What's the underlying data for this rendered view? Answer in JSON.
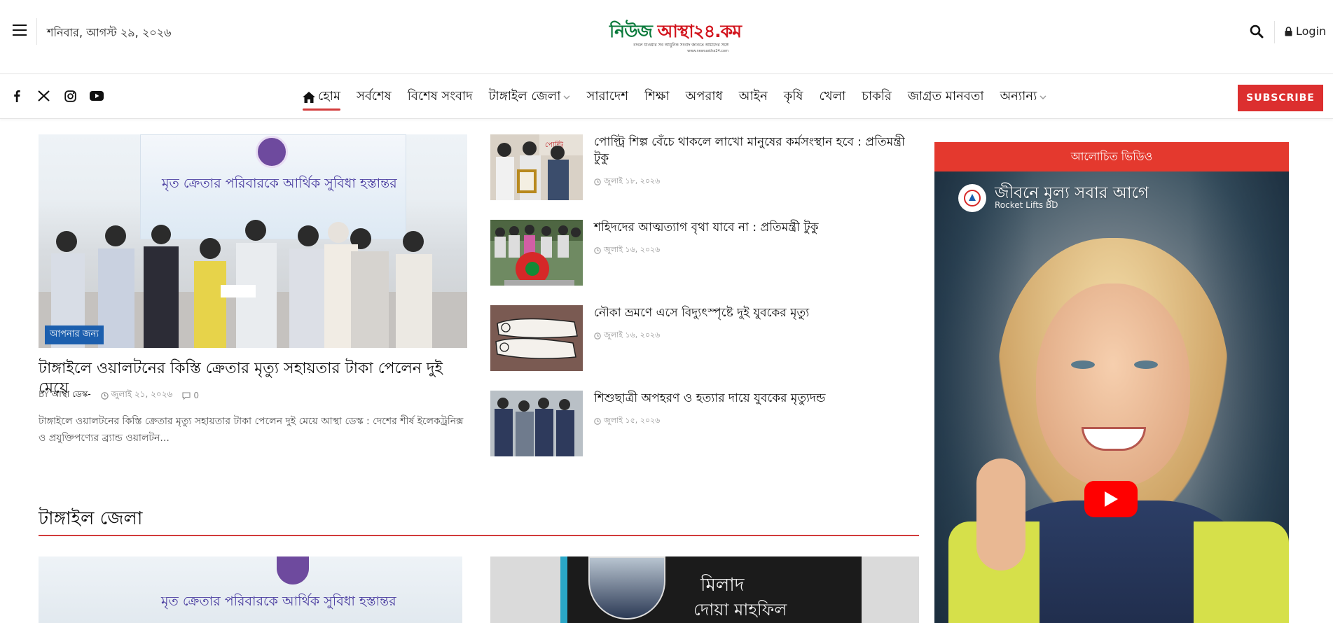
{
  "header": {
    "date": "শনিবার, আগস্ট ২৯, ২০২৬",
    "logo_part1": "নিউজ",
    "logo_part2": "আস্থা",
    "logo_part3": "২৪.কম",
    "logo_tagline": "বদলে যাওয়ার সব আধুনিক সংবাদ জানতে আমাদের সঙ্গে",
    "logo_url": "www.newsastha24.com",
    "login_label": "Login"
  },
  "social": [
    "facebook-icon",
    "x-icon",
    "instagram-icon",
    "youtube-icon"
  ],
  "nav": {
    "items": [
      {
        "label": "হোম",
        "active": true,
        "icon": "home-icon"
      },
      {
        "label": "সর্বশেষ"
      },
      {
        "label": "বিশেষ সংবাদ"
      },
      {
        "label": "টাঙ্গাইল জেলা",
        "dropdown": true
      },
      {
        "label": "সারাদেশ"
      },
      {
        "label": "শিক্ষা"
      },
      {
        "label": "অপরাধ"
      },
      {
        "label": "আইন"
      },
      {
        "label": "কৃষি"
      },
      {
        "label": "খেলা"
      },
      {
        "label": "চাকরি"
      },
      {
        "label": "জাগ্রত মানবতা"
      },
      {
        "label": "অন্যান্য",
        "dropdown": true
      }
    ],
    "subscribe_label": "SUBSCRIBE"
  },
  "featured": {
    "image_banner_text": "মৃত ক্রেতার পরিবারকে আর্থিক সুবিধা হস্তান্তর",
    "badge": "আপনার জন্য",
    "title": "টাঙ্গাইলে ওয়ালটনের কিস্তি ক্রেতার মৃত্যু সহায়তার টাকা পেলেন দুই মেয়ে",
    "author_prefix": "BY",
    "author": "আস্থা ডেস্ক-",
    "date": "জুলাই ২১, ২০২৬",
    "comments": "0",
    "excerpt": "টাঙ্গাইলে ওয়ালটনের কিস্তি ক্রেতার মৃত্যু সহায়তার টাকা পেলেন দুই মেয়ে আস্থা ডেস্ক : দেশের শীর্ষ ইলেকট্রনিক্স ও প্রযুক্তিপণ্যের ব্র্যান্ড ওয়ালটন..."
  },
  "list": [
    {
      "title": "পোল্ট্রি শিল্প বেঁচে থাকলে লাখো মানুষের কর্মসংস্থান হবে : প্রতিমন্ত্রী টুকু",
      "date": "জুলাই ১৮, ২০২৬"
    },
    {
      "title": "শহিদদের আত্মত্যাগ বৃথা যাবে না : প্রতিমন্ত্রী টুকু",
      "date": "জুলাই ১৬, ২০২৬"
    },
    {
      "title": "নৌকা ভ্রমণে এসে বিদ্যুৎস্পৃষ্টে দুই যুবকের মৃত্যু",
      "date": "জুলাই ১৬, ২০২৬"
    },
    {
      "title": "শিশুছাত্রী অপহরণ ও হত্যার দায়ে যুবকের মৃত্যুদন্ড",
      "date": "জুলাই ১৫, ২০২৬"
    }
  ],
  "section": {
    "title": "টাঙ্গাইল জেলা",
    "image1_text": "মৃত ক্রেতার পরিবারকে আর্থিক সুবিধা হস্তান্তর",
    "image2_line1": "মিলাদ",
    "image2_line2": "দোয়া মাহফিল"
  },
  "sidebar": {
    "video_heading": "আলোচিত ভিডিও",
    "video_title": "জীবনে মূল্য সবার আগে",
    "video_channel": "Rocket Lifts BD"
  },
  "colors": {
    "accent_red": "#dc2f2f",
    "logo_green": "#0a7a3b",
    "badge_blue": "#1c5fae"
  }
}
